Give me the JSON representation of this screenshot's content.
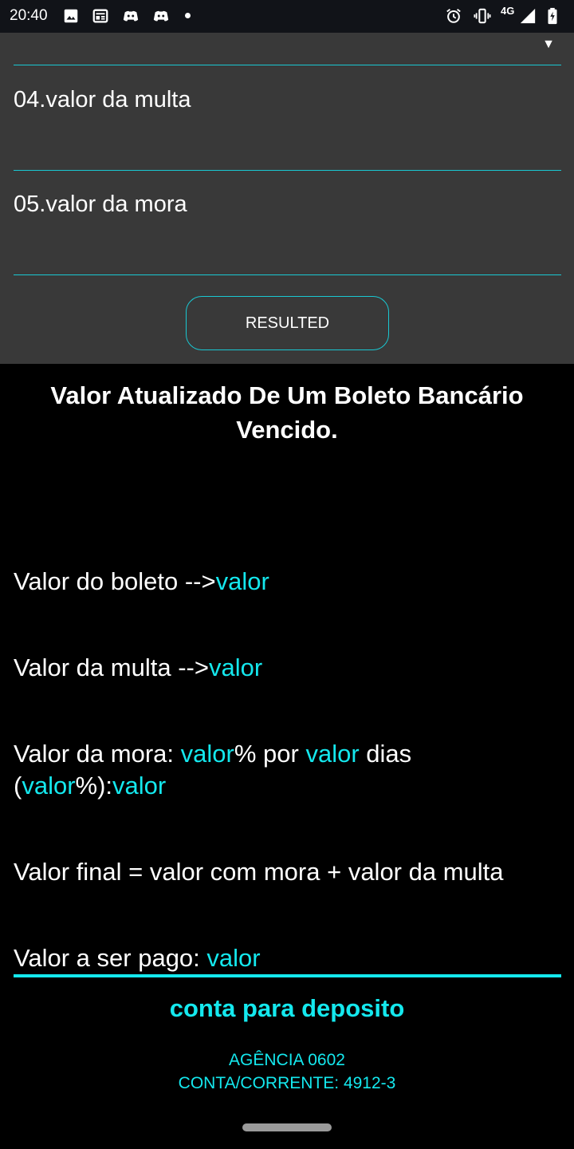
{
  "status_bar": {
    "time": "20:40",
    "network": "4G",
    "icons": [
      "image-icon",
      "news-icon",
      "discord-icon",
      "discord-icon",
      "alarm-icon",
      "vibrate-icon",
      "signal-icon",
      "battery-charging-icon"
    ]
  },
  "form": {
    "field_04_label": "04.valor da multa",
    "field_05_label": "05.valor da mora",
    "button_label": "RESULTED",
    "accent_color": "#19c8d2"
  },
  "result": {
    "title": "Valor Atualizado De Um Boleto Bancário Vencido.",
    "boleto_prefix": "Valor do boleto -->",
    "boleto_value": "valor",
    "multa_prefix": "Valor da multa -->",
    "multa_value": "valor",
    "mora_prefix": "Valor da mora: ",
    "mora_rate": "valor",
    "mora_text1": "% por ",
    "mora_days": "valor",
    "mora_text2": " dias",
    "mora_paren_open": "(",
    "mora_percent": "valor",
    "mora_text3": "%):",
    "mora_total": "valor",
    "final_text": "Valor final = valor com mora + valor da multa",
    "paid_prefix": "Valor a ser pago: ",
    "paid_value": "valor",
    "highlight_color": "#14e8ee"
  },
  "account": {
    "title": "conta para deposito",
    "agency": "AGÊNCIA 0602",
    "account": "CONTA/CORRENTE: 4912-3"
  }
}
